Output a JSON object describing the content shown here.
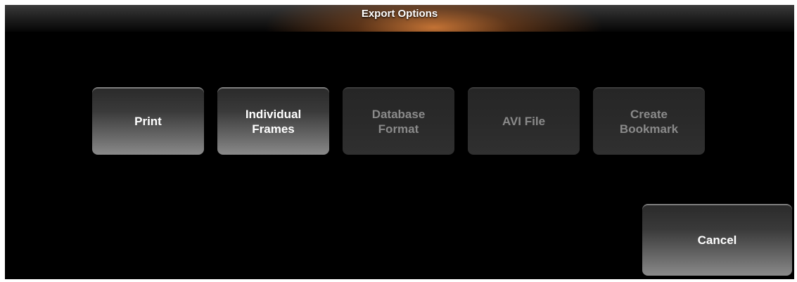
{
  "dialog": {
    "title": "Export Options"
  },
  "buttons": {
    "print": "Print",
    "individual_frames": "Individual\nFrames",
    "database_format": "Database\nFormat",
    "avi_file": "AVI File",
    "create_bookmark": "Create\nBookmark",
    "cancel": "Cancel"
  },
  "states": {
    "print": "enabled",
    "individual_frames": "enabled",
    "database_format": "disabled",
    "avi_file": "disabled",
    "create_bookmark": "disabled",
    "cancel": "enabled"
  },
  "colors": {
    "background": "#000000",
    "title_accent": "#cd7837",
    "enabled_text": "#ffffff",
    "disabled_text": "#8a8a8a"
  }
}
